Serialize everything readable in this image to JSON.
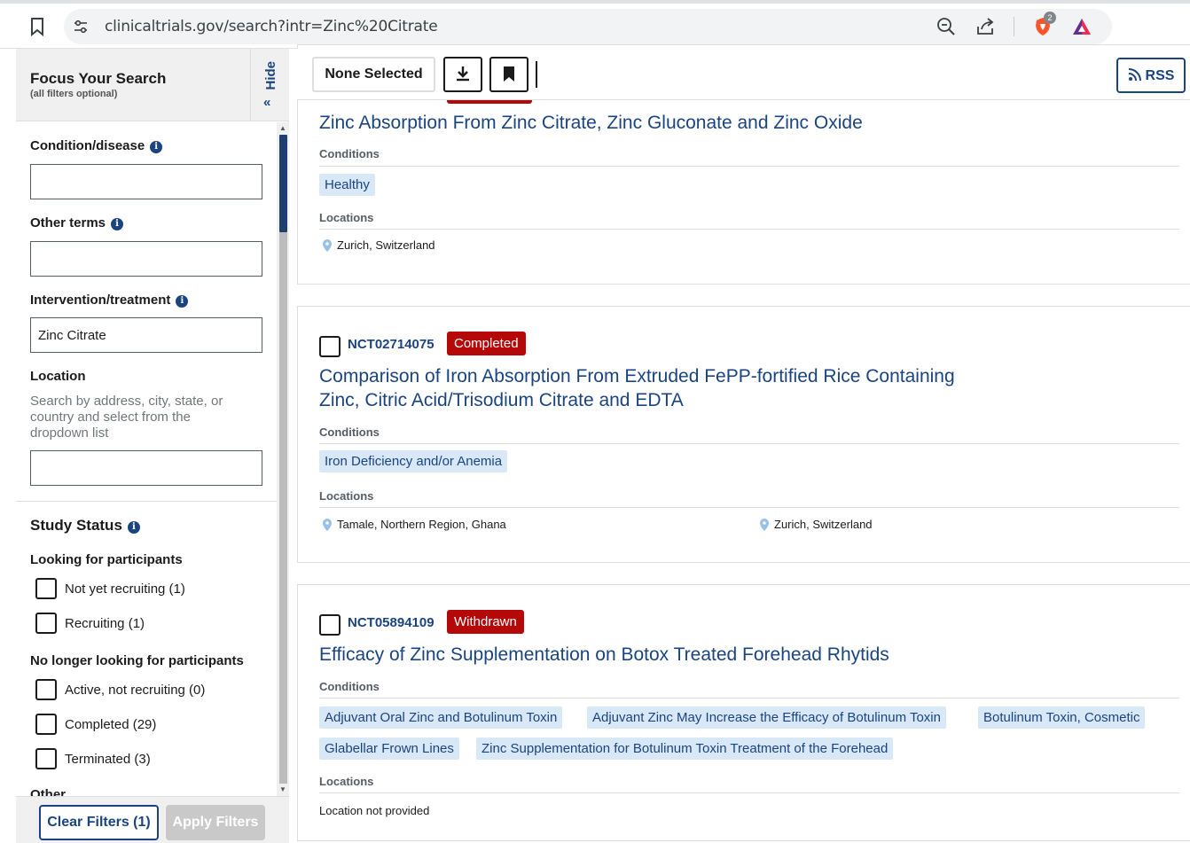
{
  "browser": {
    "url": "clinicaltrials.gov/search?intr=Zinc%20Citrate",
    "brave_badge": "2"
  },
  "sidebar": {
    "title": "Focus Your Search",
    "subtitle": "(all filters optional)",
    "hide_label": "Hide",
    "condition_label": "Condition/disease",
    "condition_value": "",
    "other_terms_label": "Other terms",
    "other_terms_value": "",
    "intervention_label": "Intervention/treatment",
    "intervention_value": "Zinc Citrate",
    "location_label": "Location",
    "location_hint": "Search by address, city, state, or country and select from the dropdown list",
    "location_value": "",
    "study_status_title": "Study Status",
    "looking_title": "Looking for participants",
    "looking_options": [
      "Not yet recruiting (1)",
      "Recruiting (1)"
    ],
    "no_longer_title": "No longer looking for participants",
    "no_longer_options": [
      "Active, not recruiting (0)",
      "Completed (29)",
      "Terminated (3)"
    ],
    "other_title": "Other",
    "clear_button": "Clear Filters (1)",
    "apply_button": "Apply Filters"
  },
  "toolbar": {
    "none_selected": "None Selected",
    "rss": "RSS"
  },
  "results": [
    {
      "title": "Zinc Absorption From Zinc Citrate, Zinc Gluconate and Zinc Oxide",
      "conditions_label": "Conditions",
      "conditions": [
        "Healthy"
      ],
      "locations_label": "Locations",
      "locations": [
        "Zurich, Switzerland"
      ]
    },
    {
      "nct": "NCT02714075",
      "status": "Completed",
      "title_line1": "Comparison of Iron Absorption From Extruded FePP-fortified Rice Containing",
      "title_line2": "Zinc, Citric Acid/Trisodium Citrate and EDTA",
      "conditions_label": "Conditions",
      "conditions": [
        "Iron Deficiency and/or Anemia"
      ],
      "locations_label": "Locations",
      "locations": [
        "Tamale, Northern Region, Ghana",
        "Zurich, Switzerland"
      ]
    },
    {
      "nct": "NCT05894109",
      "status": "Withdrawn",
      "title": "Efficacy of Zinc Supplementation on Botox Treated Forehead Rhytids",
      "conditions_label": "Conditions",
      "conditions": [
        "Adjuvant Oral Zinc and Botulinum Toxin",
        "Adjuvant Zinc May Increase the Efficacy of Botulinum Toxin",
        "Botulinum Toxin, Cosmetic",
        "Glabellar Frown Lines",
        "Zinc Supplementation for Botulinum Toxin Treatment of the Forehead"
      ],
      "locations_label": "Locations",
      "location_text": "Location not provided"
    }
  ],
  "colors": {
    "primary": "#1a4480",
    "status_red": "#b50909",
    "tag_bg": "#d9e8f6"
  }
}
